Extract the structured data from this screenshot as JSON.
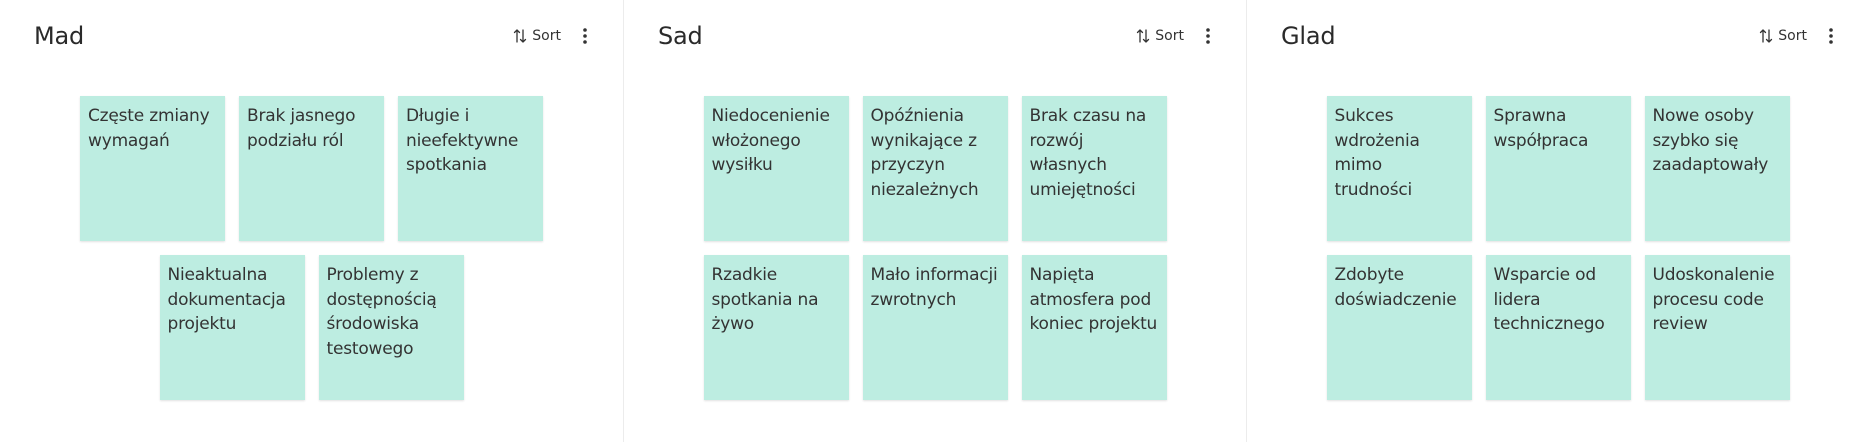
{
  "colors": {
    "note_background": "#bdede1",
    "text": "#333333",
    "divider": "#ececec"
  },
  "columns": [
    {
      "title": "Mad",
      "sort_label": "Sort",
      "sort_icon": "sort-arrows-icon",
      "menu_icon": "more-vertical-icon",
      "rows": [
        [
          "Częste zmiany wymagań",
          "Brak jasnego podziału ról",
          "Długie i nieefektywne spotkania"
        ],
        [
          "Nieaktualna dokumentacja projektu",
          "Problemy z dostępnością środowiska testowego"
        ]
      ]
    },
    {
      "title": "Sad",
      "sort_label": "Sort",
      "sort_icon": "sort-arrows-icon",
      "menu_icon": "more-vertical-icon",
      "rows": [
        [
          "Niedocenienie włożonego wysiłku",
          "Opóźnienia wynikające z przyczyn niezależnych",
          "Brak czasu na rozwój własnych umiejętności"
        ],
        [
          "Rzadkie spotkania na żywo",
          "Mało informacji zwrotnych",
          "Napięta atmosfera pod koniec projektu"
        ]
      ]
    },
    {
      "title": "Glad",
      "sort_label": "Sort",
      "sort_icon": "sort-arrows-icon",
      "menu_icon": "more-vertical-icon",
      "rows": [
        [
          "Sukces wdrożenia mimo trudności",
          "Sprawna współpraca",
          "Nowe osoby szybko się zaadaptowały"
        ],
        [
          "Zdobyte doświadczenie",
          "Wsparcie od lidera technicznego",
          "Udoskonalenie procesu code review"
        ]
      ]
    }
  ]
}
